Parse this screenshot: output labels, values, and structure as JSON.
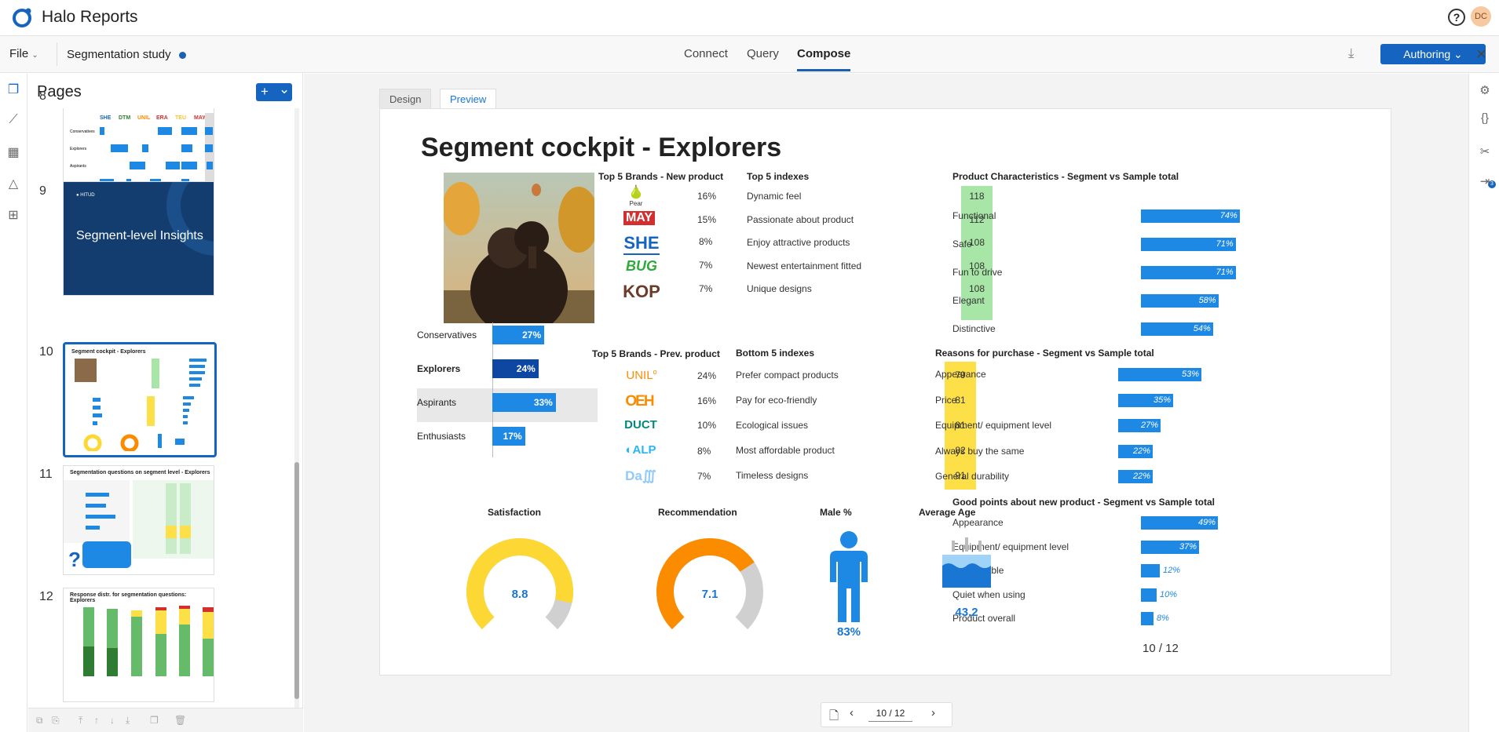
{
  "app": {
    "title": "Halo Reports",
    "help_icon": "?",
    "avatar_initials": "DC"
  },
  "menubar": {
    "file_label": "File",
    "doc_name": "Segmentation study",
    "tabs": [
      {
        "label": "Connect"
      },
      {
        "label": "Query"
      },
      {
        "label": "Compose"
      }
    ],
    "active_tab": "Compose",
    "authoring_label": "Authoring",
    "close_label": "×"
  },
  "pages_panel": {
    "title": "Pages",
    "add_label": "+",
    "dropdown_label": "⌄",
    "pages": [
      {
        "number": "8",
        "title": ""
      },
      {
        "number": "9",
        "title": "Segment-level Insights"
      },
      {
        "number": "10",
        "title": "Segment cockpit - Explorers"
      },
      {
        "number": "11",
        "title": "Segmentation questions on segment level - Explorers"
      },
      {
        "number": "12",
        "title": "Response distr. for segmentation questions: Explorers"
      }
    ]
  },
  "view_tabs": {
    "design": "Design",
    "preview": "Preview"
  },
  "slide": {
    "title": "Segment cockpit - Explorers",
    "new_brands_title": "Top 5 Brands - New product",
    "new_brands": [
      {
        "name": "Pear",
        "pct": "16%"
      },
      {
        "name": "MAY",
        "pct": "15%"
      },
      {
        "name": "SHE",
        "pct": "8%"
      },
      {
        "name": "BUG",
        "pct": "7%"
      },
      {
        "name": "KOP",
        "pct": "7%"
      }
    ],
    "prev_brands_title": "Top 5 Brands - Prev. product",
    "prev_brands": [
      {
        "name": "UNIL",
        "pct": "24%"
      },
      {
        "name": "OEH",
        "pct": "16%"
      },
      {
        "name": "DUCT",
        "pct": "10%"
      },
      {
        "name": "ALP",
        "pct": "8%"
      },
      {
        "name": "Da",
        "pct": "7%"
      }
    ],
    "top_indexes_title": "Top 5 indexes",
    "top_indexes": [
      {
        "label": "Dynamic feel",
        "value": "118"
      },
      {
        "label": "Passionate about product",
        "value": "112"
      },
      {
        "label": "Enjoy attractive products",
        "value": "108"
      },
      {
        "label": "Newest entertainment fitted",
        "value": "108"
      },
      {
        "label": "Unique designs",
        "value": "108"
      }
    ],
    "bottom_indexes_title": "Bottom 5 indexes",
    "bottom_indexes": [
      {
        "label": "Prefer compact products",
        "value": "79"
      },
      {
        "label": "Pay for eco-friendly",
        "value": "81"
      },
      {
        "label": "Ecological issues",
        "value": "81"
      },
      {
        "label": "Most affordable product",
        "value": "82"
      },
      {
        "label": "Timeless designs",
        "value": "91"
      }
    ],
    "segments": [
      {
        "label": "Conservatives",
        "value": "27%",
        "num": 27,
        "selected": false
      },
      {
        "label": "Explorers",
        "value": "24%",
        "num": 24,
        "selected": true
      },
      {
        "label": "Aspirants",
        "value": "33%",
        "num": 33,
        "selected": false
      },
      {
        "label": "Enthusiasts",
        "value": "17%",
        "num": 17,
        "selected": false
      }
    ],
    "product_chars_title": "Product Characteristics - Segment vs Sample total",
    "product_chars": [
      {
        "label": "Functional",
        "value": "74%",
        "num": 74
      },
      {
        "label": "Safe",
        "value": "71%",
        "num": 71
      },
      {
        "label": "Fun to drive",
        "value": "71%",
        "num": 71
      },
      {
        "label": "Elegant",
        "value": "58%",
        "num": 58
      },
      {
        "label": "Distinctive",
        "value": "54%",
        "num": 54
      }
    ],
    "reasons_title": "Reasons for purchase - Segment vs Sample total",
    "reasons": [
      {
        "label": "Appearance",
        "value": "53%",
        "num": 53
      },
      {
        "label": "Price",
        "value": "35%",
        "num": 35
      },
      {
        "label": "Equipment/ equipment level",
        "value": "27%",
        "num": 27
      },
      {
        "label": "Always buy the same",
        "value": "22%",
        "num": 22
      },
      {
        "label": "General durability",
        "value": "22%",
        "num": 22
      }
    ],
    "good_points_title": "Good points about new product - Segment vs Sample total",
    "good_points": [
      {
        "label": "Appearance",
        "value": "49%",
        "num": 49
      },
      {
        "label": "Equipment/ equipment level",
        "value": "37%",
        "num": 37
      },
      {
        "label": "Comfortable",
        "value": "12%",
        "num": 12
      },
      {
        "label": "Quiet when using",
        "value": "10%",
        "num": 10
      },
      {
        "label": "Product overall",
        "value": "8%",
        "num": 8
      }
    ],
    "satisfaction": {
      "label": "Satisfaction",
      "value": "8.8",
      "num": 8.8,
      "max": 10,
      "color": "#fdd835"
    },
    "recommendation": {
      "label": "Recommendation",
      "value": "7.1",
      "num": 7.1,
      "max": 10,
      "color": "#fb8c00"
    },
    "male": {
      "label": "Male %",
      "value": "83%"
    },
    "age": {
      "label": "Average Age",
      "value": "43.2"
    },
    "page_indicator": "10 / 12"
  },
  "pager": {
    "value": "10 / 12"
  },
  "colors": {
    "accent": "#1565c0",
    "bar": "#1e88e5",
    "green_index": "#a8e6a8",
    "yellow_index": "#fde047"
  }
}
